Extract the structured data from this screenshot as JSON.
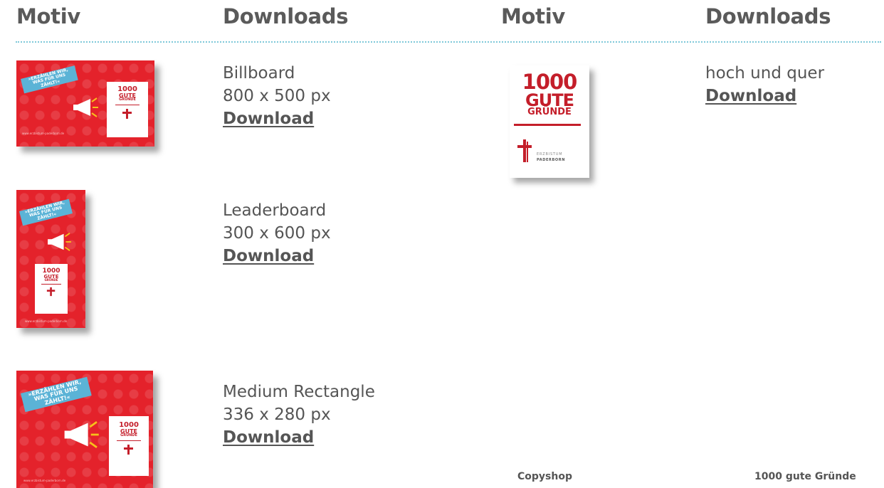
{
  "headers": {
    "col1": "Motiv",
    "col2": "Downloads",
    "col3": "Motiv",
    "col4": "Downloads"
  },
  "thumbnail": {
    "banner": "»ERZÄHLEN WIR, WAS FÜR UNS ZÄHLT!«",
    "logo_line1": "1000",
    "logo_line2": "GUTE",
    "logo_line3": "GRÜNDE",
    "footer": "www.erzbistum-paderborn.de"
  },
  "ads": [
    {
      "name": "Billboard",
      "size": "800 x 500 px",
      "link": "Download"
    },
    {
      "name": "Leaderboard",
      "size": "300 x 600 px",
      "link": "Download"
    },
    {
      "name": "Medium Rectangle",
      "size": "336 x 280 px",
      "link": "Download"
    }
  ],
  "logo_item": {
    "line1": "1000",
    "line2": "GUTE",
    "line3": "GRÜNDE",
    "org_line1": "ERZBISTUM",
    "org_line2": "PADERBORN",
    "description": "hoch und quer",
    "link": "Download"
  },
  "footer": {
    "left": "Copyshop",
    "right": "1000 gute Gründe"
  },
  "colors": {
    "brand_red": "#e4222b",
    "banner_blue": "#5bb3d6",
    "divider": "#7fc9d9",
    "text": "#555555"
  }
}
